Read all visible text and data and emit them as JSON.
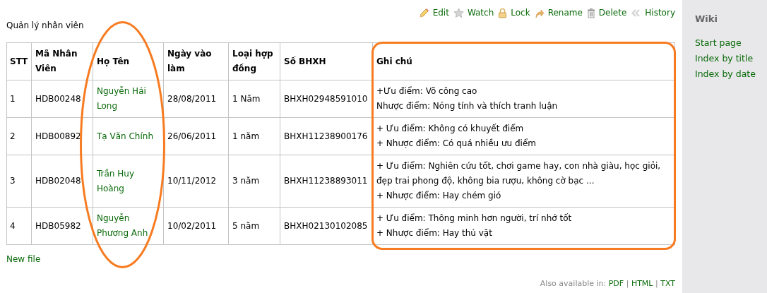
{
  "actions": [
    {
      "kind": "edit",
      "label": "Edit"
    },
    {
      "kind": "watch",
      "label": "Watch"
    },
    {
      "kind": "lock",
      "label": "Lock"
    },
    {
      "kind": "rename",
      "label": "Rename"
    },
    {
      "kind": "delete",
      "label": "Delete"
    },
    {
      "kind": "history",
      "label": "History"
    }
  ],
  "page_title": "Quản lý nhân viên",
  "table": {
    "columns": [
      {
        "label": "STT",
        "kind": "text"
      },
      {
        "label": "Mã Nhân Viên",
        "kind": "text"
      },
      {
        "label": "Họ Tên",
        "kind": "link",
        "highlight": {
          "kind": "ellipse"
        }
      },
      {
        "label": "Ngày vào làm",
        "kind": "text"
      },
      {
        "label": "Loại hợp đồng",
        "kind": "text"
      },
      {
        "label": "Số BHXH",
        "kind": "text"
      },
      {
        "label": "Ghi chú",
        "kind": "notes",
        "highlight": {
          "kind": "frame"
        }
      }
    ],
    "rows": [
      {
        "cells": [
          "1",
          "HDB00248",
          "Nguyễn Hải Long",
          "28/08/2011",
          "1 Năm",
          "BHXH02948591010",
          [
            "+Ưu điểm: Võ công cao",
            "Nhược điểm: Nóng tính và thích tranh luận"
          ]
        ]
      },
      {
        "cells": [
          "2",
          "HDB00892",
          "Tạ Văn Chính",
          "26/06/2011",
          "1 năm",
          "BHXH11238900176",
          [
            "+ Ưu điểm: Không có khuyết điểm",
            "+ Nhược điểm: Có quá nhiều ưu điểm"
          ]
        ]
      },
      {
        "cells": [
          "3",
          "HDB02048",
          "Trần Huy Hoàng",
          "10/11/2012",
          "3 năm",
          "BHXH11238893011",
          [
            "+ Ưu điểm: Nghiên cứu tốt, chơi game hay, con nhà giàu, học giỏi, đẹp trai phong độ, không bia rượu, không cờ bạc ...",
            "+ Nhược điểm: Hay chém gió"
          ]
        ]
      },
      {
        "cells": [
          "4",
          "HDB05982",
          "Nguyễn Phương Anh",
          "10/02/2011",
          "5 năm",
          "BHXH02130102085",
          [
            "+ Ưu điểm: Thông minh hơn người, trí nhớ tốt",
            "+ Nhược điểm: Hay thủ vặt"
          ]
        ]
      }
    ]
  },
  "new_file": "New file",
  "formats": {
    "label": "Also available in:",
    "separator": "|",
    "links": [
      "PDF",
      "HTML",
      "TXT"
    ]
  },
  "sidebar": {
    "title": "Wiki",
    "links": [
      "Start page",
      "Index by title",
      "Index by date"
    ]
  }
}
